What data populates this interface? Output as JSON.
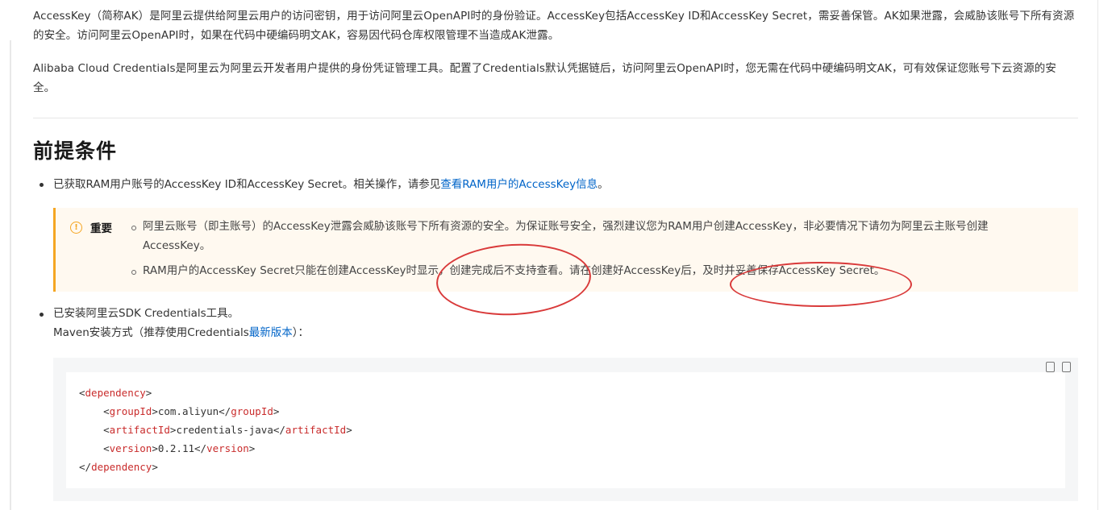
{
  "intro": {
    "p1": "AccessKey（简称AK）是阿里云提供给阿里云用户的访问密钥，用于访问阿里云OpenAPI时的身份验证。AccessKey包括AccessKey ID和AccessKey Secret，需妥善保管。AK如果泄露，会威胁该账号下所有资源的安全。访问阿里云OpenAPI时，如果在代码中硬编码明文AK，容易因代码仓库权限管理不当造成AK泄露。",
    "p2": "Alibaba Cloud Credentials是阿里云为阿里云开发者用户提供的身份凭证管理工具。配置了Credentials默认凭据链后，访问阿里云OpenAPI时，您无需在代码中硬编码明文AK，可有效保证您账号下云资源的安全。"
  },
  "section": {
    "title": "前提条件"
  },
  "prereq": {
    "item1_text": "已获取RAM用户账号的AccessKey ID和AccessKey Secret。相关操作，请参见",
    "item1_link": "查看RAM用户的AccessKey信息",
    "item1_end": "。",
    "item2_line1": "已安装阿里云SDK Credentials工具。",
    "item2_line2": "Maven安装方式（推荐使用Credentials",
    "item2_link": "最新版本",
    "item2_end": "）："
  },
  "note": {
    "icon": "warning-icon",
    "title": "重要",
    "items": [
      "阿里云账号（即主账号）的AccessKey泄露会威胁该账号下所有资源的安全。为保证账号安全，强烈建议您为RAM用户创建AccessKey，非必要情况下请勿为阿里云主账号创建AccessKey。",
      "RAM用户的AccessKey Secret只能在创建AccessKey时显示，创建完成后不支持查看。请在创建好AccessKey后，及时并妥善保存AccessKey Secret。"
    ]
  },
  "code": {
    "tools": [
      "copy-icon",
      "clipboard-icon"
    ],
    "lines": [
      {
        "indent": "",
        "tag_open": "<",
        "tag": "dependency",
        "tag_close": ">",
        "text": "",
        "end": ""
      },
      {
        "indent": "    ",
        "tag_open": "<",
        "tag": "groupId",
        "tag_close": ">",
        "text": "com.aliyun",
        "end": "groupId"
      },
      {
        "indent": "    ",
        "tag_open": "<",
        "tag": "artifactId",
        "tag_close": ">",
        "text": "credentials-java",
        "end": "artifactId"
      },
      {
        "indent": "    ",
        "tag_open": "<",
        "tag": "version",
        "tag_close": ">",
        "text": "0.2.11",
        "end": "version"
      },
      {
        "indent": "",
        "tag_open": "</",
        "tag": "dependency",
        "tag_close": ">",
        "text": "",
        "end": ""
      }
    ]
  },
  "colors": {
    "link": "#0064c8",
    "warning": "#f5a623",
    "annotation": "#d93a3a",
    "code_tag": "#c92c2c"
  }
}
